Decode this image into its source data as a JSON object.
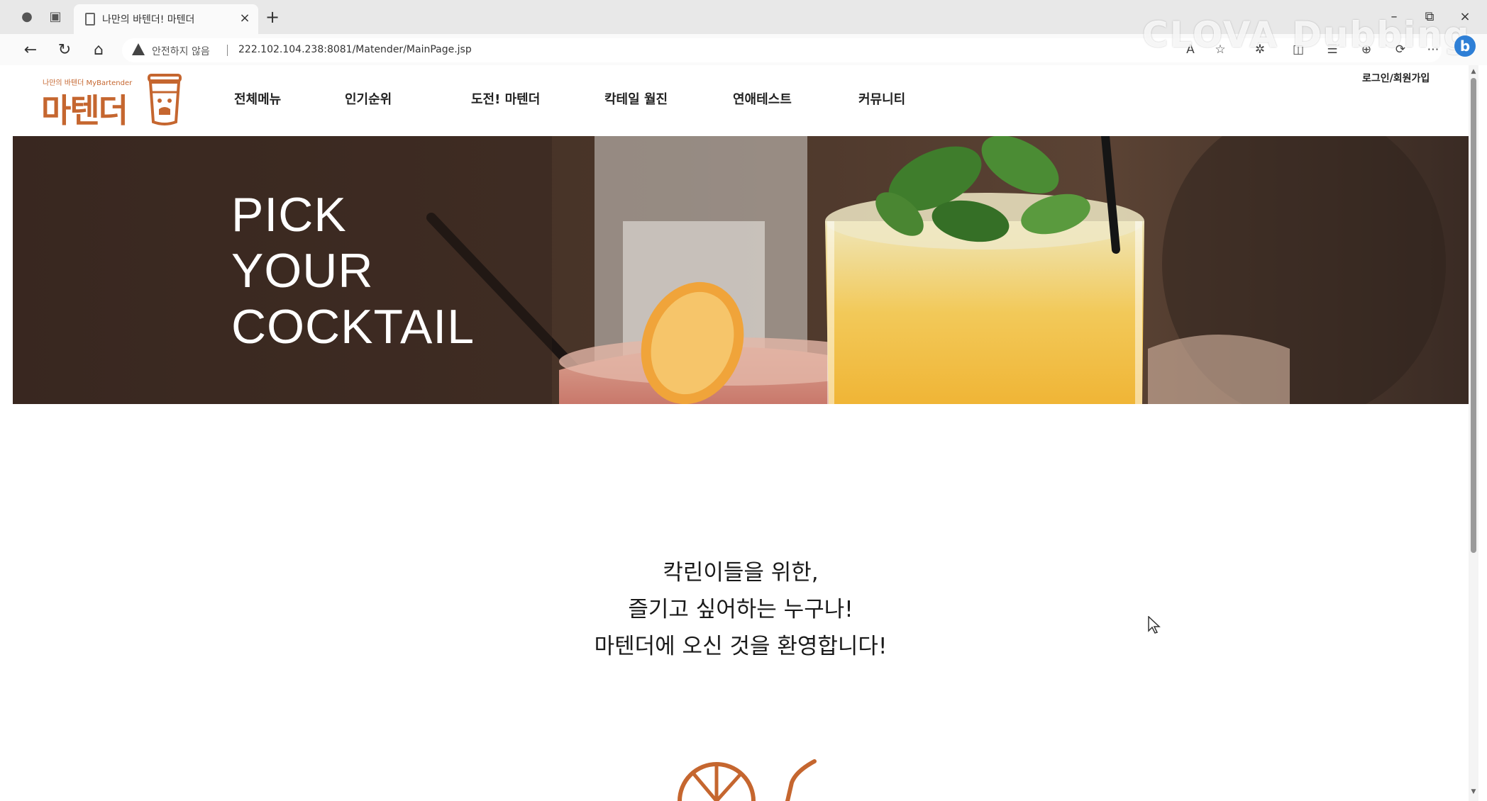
{
  "browser": {
    "tab_title": "나만의 바텐더! 마텐더",
    "security_label": "안전하지 않음",
    "url": "222.102.104.238:8081/Matender/MainPage.jsp",
    "watermark": "CLOVA Dubbing",
    "icons": [
      "profile-icon",
      "workspaces-icon",
      "page-icon",
      "close-icon",
      "new-tab-icon",
      "minimize-icon",
      "restore-icon",
      "window-close-icon",
      "back-icon",
      "reload-icon",
      "home-icon",
      "warning-icon",
      "read-aloud-icon",
      "favorite-icon",
      "extensions-icon",
      "split-screen-icon",
      "favorites-bar-icon",
      "collections-icon",
      "sync-icon",
      "more-icon",
      "bing-icon"
    ]
  },
  "site": {
    "logo_sub": "나만의 바텐더 MyBartender",
    "logo_main": "마텐더",
    "nav": [
      "전체메뉴",
      "인기순위",
      "도전! 마텐더",
      "칵테일 월진",
      "연애테스트",
      "커뮤니티"
    ],
    "login": "로그인/회원가입"
  },
  "hero": {
    "lines": [
      "PICK",
      "YOUR",
      "COCKTAIL"
    ]
  },
  "intro": {
    "lines": [
      "칵린이들을 위한,",
      "즐기고 싶어하는 누구나!",
      "마텐더에 오신 것을 환영합니다!"
    ]
  },
  "colors": {
    "brand": "#c5662f",
    "hero_overlay": "#3a2a22",
    "juice": "#f2c14e"
  }
}
